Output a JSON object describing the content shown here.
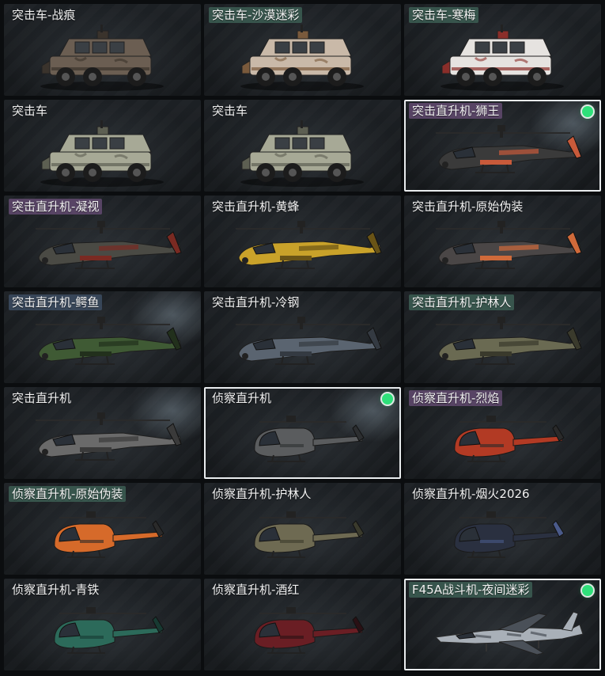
{
  "grid": {
    "items": [
      {
        "label": "突击车-战痕",
        "kind": "truck",
        "body_color": "#6b5e52",
        "accent": "#3a332c",
        "tag": "plain",
        "selected": false
      },
      {
        "label": "突击车-沙漠迷彩",
        "kind": "truck",
        "body_color": "#c9b9a8",
        "accent": "#7a5a3c",
        "tag": "teal",
        "selected": false
      },
      {
        "label": "突击车-寒梅",
        "kind": "truck",
        "body_color": "#e6e3e0",
        "accent": "#8a2e2a",
        "tag": "teal",
        "selected": false
      },
      {
        "label": "突击车",
        "kind": "truck",
        "body_color": "#a7a996",
        "accent": "#5d5f52",
        "tag": "plain",
        "selected": false
      },
      {
        "label": "突击车",
        "kind": "truck",
        "body_color": "#a7a996",
        "accent": "#5d5f52",
        "tag": "plain",
        "selected": false
      },
      {
        "label": "突击直升机-狮王",
        "kind": "attack-heli",
        "body_color": "#3a3a3a",
        "accent": "#c85a3a",
        "tag": "purple",
        "selected": true
      },
      {
        "label": "突击直升机-凝视",
        "kind": "attack-heli",
        "body_color": "#4a4a44",
        "accent": "#7a2a22",
        "tag": "purple",
        "selected": false
      },
      {
        "label": "突击直升机-黄蜂",
        "kind": "attack-heli",
        "body_color": "#c9a22a",
        "accent": "#6a5416",
        "tag": "plain",
        "selected": false
      },
      {
        "label": "突击直升机-原始伪装",
        "kind": "attack-heli",
        "body_color": "#4a4646",
        "accent": "#d06a3a",
        "tag": "plain",
        "selected": false
      },
      {
        "label": "突击直升机-鳄鱼",
        "kind": "attack-heli",
        "body_color": "#3f5a34",
        "accent": "#22301c",
        "tag": "slate",
        "selected": false
      },
      {
        "label": "突击直升机-冷钢",
        "kind": "attack-heli",
        "body_color": "#5a6470",
        "accent": "#343a42",
        "tag": "plain",
        "selected": false
      },
      {
        "label": "突击直升机-护林人",
        "kind": "attack-heli",
        "body_color": "#6a6a52",
        "accent": "#3a3a2c",
        "tag": "teal",
        "selected": false
      },
      {
        "label": "突击直升机",
        "kind": "attack-heli",
        "body_color": "#6a6a6a",
        "accent": "#3a3a3a",
        "tag": "plain",
        "selected": false
      },
      {
        "label": "侦察直升机",
        "kind": "scout-heli",
        "body_color": "#5a5c5e",
        "accent": "#2c2e30",
        "tag": "plain",
        "selected": true
      },
      {
        "label": "侦察直升机-烈焰",
        "kind": "scout-heli",
        "body_color": "#b23a24",
        "accent": "#2a2a2a",
        "tag": "purple",
        "selected": false
      },
      {
        "label": "侦察直升机-原始伪装",
        "kind": "scout-heli",
        "body_color": "#d66a2a",
        "accent": "#2a2a2a",
        "tag": "teal",
        "selected": false
      },
      {
        "label": "侦察直升机-护林人",
        "kind": "scout-heli",
        "body_color": "#6e6a52",
        "accent": "#3a3a2c",
        "tag": "plain",
        "selected": false
      },
      {
        "label": "侦察直升机-烟火2026",
        "kind": "scout-heli",
        "body_color": "#2a3040",
        "accent": "#4a5a8a",
        "tag": "plain",
        "selected": false
      },
      {
        "label": "侦察直升机-青铁",
        "kind": "scout-heli",
        "body_color": "#2c6a5a",
        "accent": "#173a32",
        "tag": "plain",
        "selected": false
      },
      {
        "label": "侦察直升机-酒红",
        "kind": "scout-heli",
        "body_color": "#6a1e24",
        "accent": "#2a1014",
        "tag": "plain",
        "selected": false
      },
      {
        "label": "F45A战斗机-夜间迷彩",
        "kind": "jet",
        "body_color": "#a9b0b8",
        "accent": "#4a5058",
        "tag": "teal",
        "selected": true
      }
    ]
  }
}
